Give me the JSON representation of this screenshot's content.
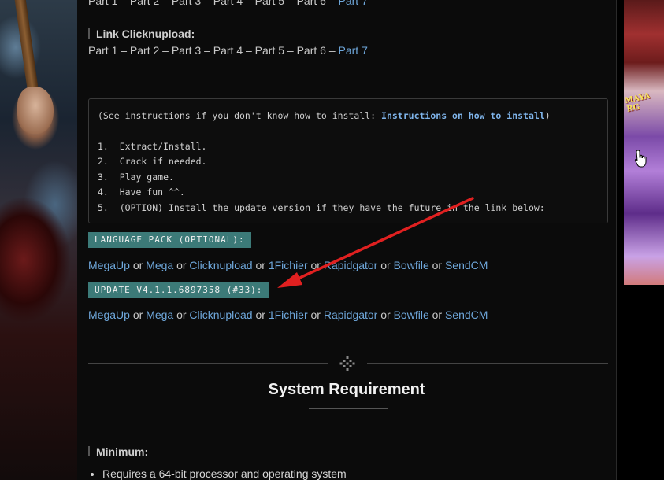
{
  "top_partial_links": {
    "prefix": "Part 1 – Part 2 – Part 3 – Part 4 – Part 5 – Part 6 – ",
    "last": "Part 7"
  },
  "clicknupload": {
    "label": "Link Clicknupload:",
    "prefix": "Part 1 – Part 2 – Part 3 – Part 4 – Part 5 – Part 6 – ",
    "last": "Part 7"
  },
  "instructions": {
    "intro_prefix": "(See instructions if you don't know how to install: ",
    "intro_link": "Instructions on how to install",
    "intro_suffix": ")",
    "steps": [
      "1.  Extract/Install.",
      "2.  Crack if needed.",
      "3.  Play game.",
      "4.  Have fun ^^.",
      "5.  (OPTION) Install the update version if they have the future in the link below:"
    ]
  },
  "language_pack": {
    "badge": "LANGUAGE PACK (OPTIONAL):",
    "links": [
      "MegaUp",
      "Mega",
      "Clicknupload",
      "1Fichier",
      "Rapidgator",
      "Bowfile",
      "SendCM"
    ],
    "separator": "or"
  },
  "update": {
    "badge": "UPDATE V4.1.1.6897358 (#33):",
    "links": [
      "MegaUp",
      "Mega",
      "Clicknupload",
      "1Fichier",
      "Rapidgator",
      "Bowfile",
      "SendCM"
    ],
    "separator": "or"
  },
  "system_requirement": {
    "title": "System Requirement",
    "minimum_label": "Minimum:",
    "items": [
      "Requires a 64-bit processor and operating system"
    ]
  },
  "ad": {
    "logo_text": "MAYA RG"
  },
  "colors": {
    "link": "#6fa8dc",
    "badge_bg": "#3c7a78",
    "arrow": "#e02020",
    "background": "#0b0b0b"
  }
}
